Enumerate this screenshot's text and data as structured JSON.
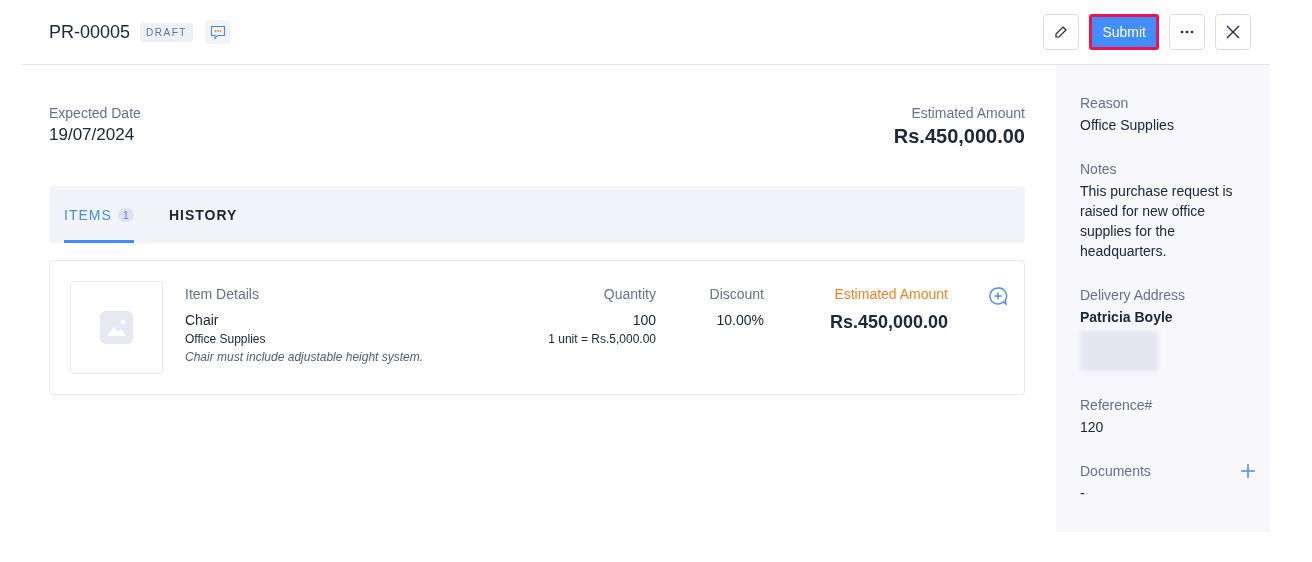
{
  "header": {
    "title": "PR-00005",
    "status": "DRAFT",
    "actions": [
      {
        "kind": "edit"
      },
      {
        "kind": "primary",
        "label": "Submit",
        "highlighted": true
      },
      {
        "kind": "more"
      },
      {
        "kind": "close"
      }
    ]
  },
  "summary": {
    "date_label": "Expected Date",
    "date": "19/07/2024",
    "amount_label": "Estimated Amount",
    "amount": "Rs.450,000.00"
  },
  "tabs": [
    {
      "label": "ITEMS",
      "count": "1",
      "selected": true
    },
    {
      "label": "HISTORY",
      "selected": false
    }
  ],
  "items_table": {
    "columns": [
      "Item Details",
      "Quantity",
      "Discount",
      "Estimated Amount"
    ],
    "rows": [
      {
        "name": "Chair",
        "category": "Office Supplies",
        "description": "Chair must include adjustable height system.",
        "quantity": "100",
        "unit_price": "1 unit = Rs.5,000.00",
        "discount": "10.00%",
        "amount": "Rs.450,000.00"
      }
    ]
  },
  "sidebar": {
    "fields": [
      {
        "kind": "text",
        "label": "Reason",
        "value": "Office Supplies"
      },
      {
        "kind": "text",
        "label": "Notes",
        "value": "This purchase request is raised for new office supplies for the headquarters."
      },
      {
        "kind": "address",
        "label": "Delivery Address",
        "value": "Patricia Boyle"
      },
      {
        "kind": "text",
        "label": "Reference#",
        "value": "120"
      },
      {
        "kind": "documents",
        "label": "Documents",
        "value": "-"
      }
    ]
  }
}
